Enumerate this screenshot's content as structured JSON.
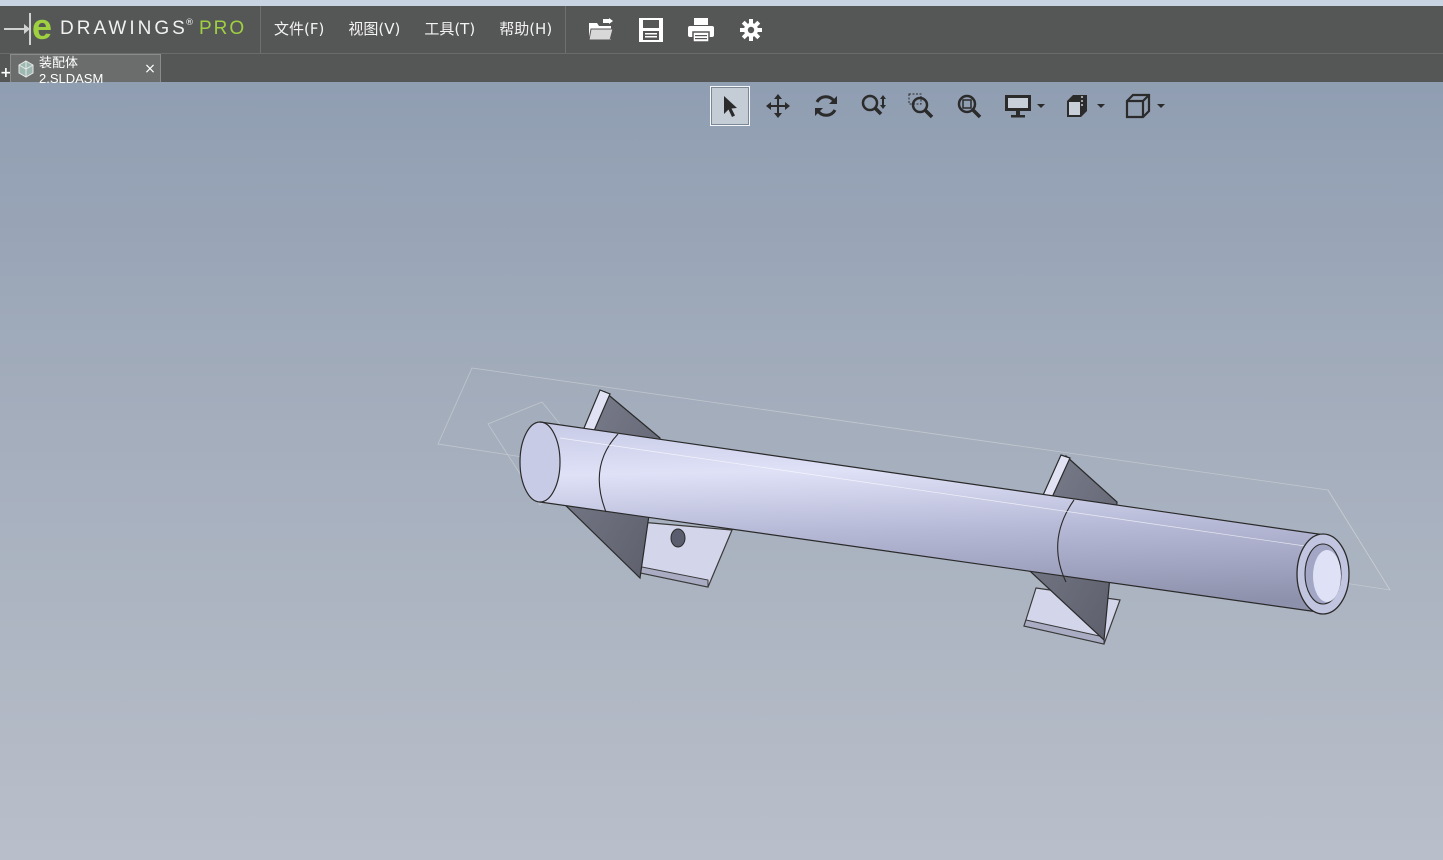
{
  "app": {
    "logo_word": "DRAWINGS",
    "logo_mark": "®",
    "logo_pro": "PRO"
  },
  "menu": [
    {
      "label": "文件(F)"
    },
    {
      "label": "视图(V)"
    },
    {
      "label": "工具(T)"
    },
    {
      "label": "帮助(H)"
    }
  ],
  "toolbar": [
    "open-folder-icon",
    "save-icon",
    "print-icon",
    "settings-gear-icon"
  ],
  "tabs": [
    {
      "label": "装配体2.SLDASM",
      "close": "×",
      "active": true
    }
  ],
  "new_tab_label": "+",
  "view_tools": [
    {
      "name": "select-arrow-icon",
      "active": true
    },
    {
      "name": "pan-move-icon"
    },
    {
      "name": "rotate-icon"
    },
    {
      "name": "zoom-icon"
    },
    {
      "name": "zoom-to-area-icon"
    },
    {
      "name": "zoom-to-fit-icon"
    },
    {
      "name": "display-style-icon",
      "dropdown": true
    },
    {
      "name": "section-view-icon",
      "dropdown": true
    },
    {
      "name": "standard-views-cube-icon",
      "dropdown": true
    }
  ],
  "colors": {
    "menubar": "#555756",
    "logo_accent": "#9fd040",
    "viewport_top": "#8b9ab0",
    "viewport_bottom": "#b9bfca",
    "part_light": "#d3d6f2",
    "part_dark": "#6c6f80"
  }
}
